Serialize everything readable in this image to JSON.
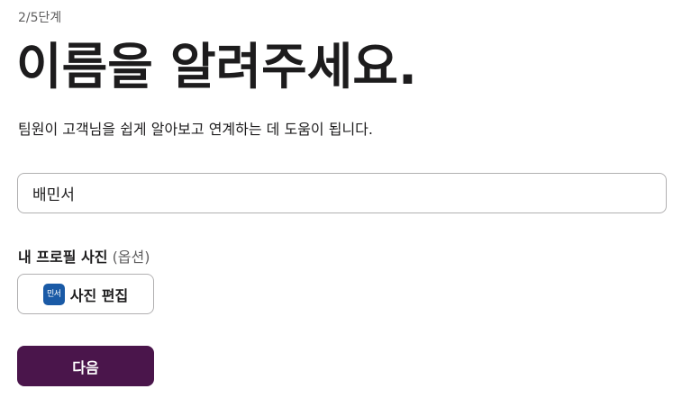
{
  "step": {
    "text": "2/5단계"
  },
  "title": "이름을 알려주세요.",
  "subtitle": "팀원이 고객님을 쉽게 알아보고 연계하는 데 도움이 됩니다.",
  "name_input": {
    "value": "배민서"
  },
  "photo": {
    "label": "내 프로필 사진",
    "optional": "(옵션)",
    "avatar_text": "민서",
    "avatar_color": "#1a5aa6",
    "edit_button_label": "사진 편집"
  },
  "next_button": {
    "label": "다음",
    "color": "#4a154b"
  }
}
